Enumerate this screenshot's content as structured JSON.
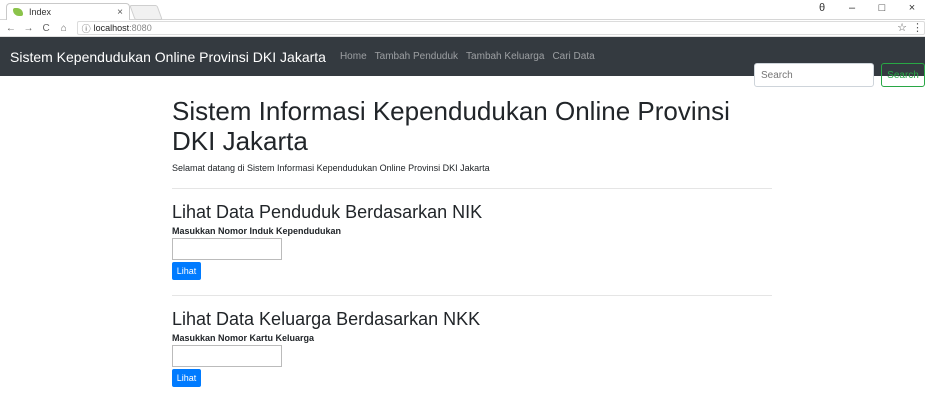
{
  "browser": {
    "tab_title": "Index",
    "tab_close": "×",
    "url_host": "localhost",
    "url_port": ":8080",
    "window_controls": {
      "account": "θ",
      "minimize": "–",
      "maximize": "□",
      "close": "×"
    },
    "nav": {
      "back": "←",
      "forward": "→",
      "reload": "C",
      "home": "⌂"
    },
    "info_icon": "ⓘ",
    "star": "☆",
    "menu": "⋮"
  },
  "navbar": {
    "brand": "Sistem Kependudukan Online Provinsi DKI Jakarta",
    "links": [
      {
        "label": "Home"
      },
      {
        "label": "Tambah Penduduk"
      },
      {
        "label": "Tambah Keluarga"
      },
      {
        "label": "Cari Data"
      }
    ],
    "search_placeholder": "Search",
    "search_button": "Search"
  },
  "main": {
    "title": "Sistem Informasi Kependudukan Online Provinsi DKI Jakarta",
    "lead": "Selamat datang di Sistem Informasi Kependudukan Online Provinsi DKI Jakarta",
    "sections": [
      {
        "title": "Lihat Data Penduduk Berdasarkan NIK",
        "label": "Masukkan Nomor Induk Kependudukan",
        "value": "",
        "button": "Lihat"
      },
      {
        "title": "Lihat Data Keluarga Berdasarkan NKK",
        "label": "Masukkan Nomor Kartu Keluarga",
        "value": "",
        "button": "Lihat"
      }
    ]
  },
  "colors": {
    "navbar_bg": "#343a40",
    "primary": "#007bff",
    "success": "#28a745"
  }
}
